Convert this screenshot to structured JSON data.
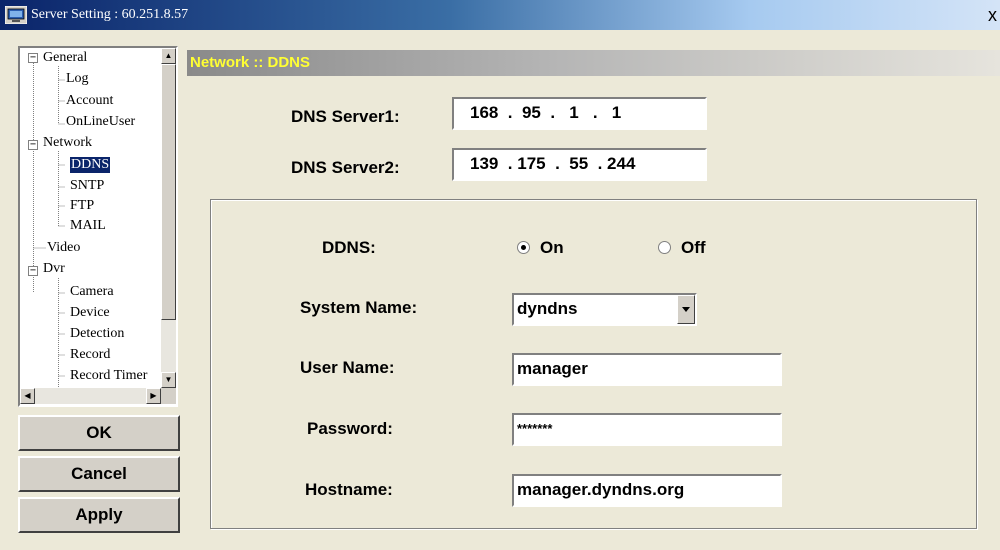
{
  "window": {
    "title": "Server Setting : 60.251.8.57",
    "close_glyph": "x",
    "icon": "server-window-icon"
  },
  "tree": {
    "items": [
      {
        "label": "General",
        "expander": "−",
        "level": 0
      },
      {
        "label": "Log",
        "level": 1
      },
      {
        "label": "Account",
        "level": 1
      },
      {
        "label": "OnLineUser",
        "level": 1
      },
      {
        "label": "Network",
        "expander": "−",
        "level": 0
      },
      {
        "label": "DDNS",
        "level": 1,
        "selected": true
      },
      {
        "label": "SNTP",
        "level": 1
      },
      {
        "label": "FTP",
        "level": 1
      },
      {
        "label": "MAIL",
        "level": 1
      },
      {
        "label": "Video",
        "level": 0
      },
      {
        "label": "Dvr",
        "expander": "−",
        "level": 0
      },
      {
        "label": "Camera",
        "level": 1
      },
      {
        "label": "Device",
        "level": 1
      },
      {
        "label": "Detection",
        "level": 1
      },
      {
        "label": "Record",
        "level": 1
      },
      {
        "label": "Record Timer",
        "level": 1
      }
    ]
  },
  "buttons": {
    "ok": "OK",
    "cancel": "Cancel",
    "apply": "Apply"
  },
  "header": {
    "title": "Network :: DDNS",
    "title_color": "#ffff33"
  },
  "dns": {
    "server1_label": "DNS Server1:",
    "server1_value": "168  .  95  .   1   .   1",
    "server2_label": "DNS Server2:",
    "server2_value": "139  . 175  .  55  . 244"
  },
  "ddns": {
    "label": "DDNS:",
    "on_label": "On",
    "off_label": "Off",
    "selected": "On"
  },
  "system_name": {
    "label": "System Name:",
    "value": "dyndns"
  },
  "user_name": {
    "label": "User Name:",
    "value": "manager"
  },
  "password": {
    "label": "Password:",
    "value": "*******"
  },
  "hostname": {
    "label": "Hostname:",
    "value": "manager.dyndns.org"
  },
  "colors": {
    "selection": "#0a246a",
    "dialog_bg": "#ece9d8"
  }
}
